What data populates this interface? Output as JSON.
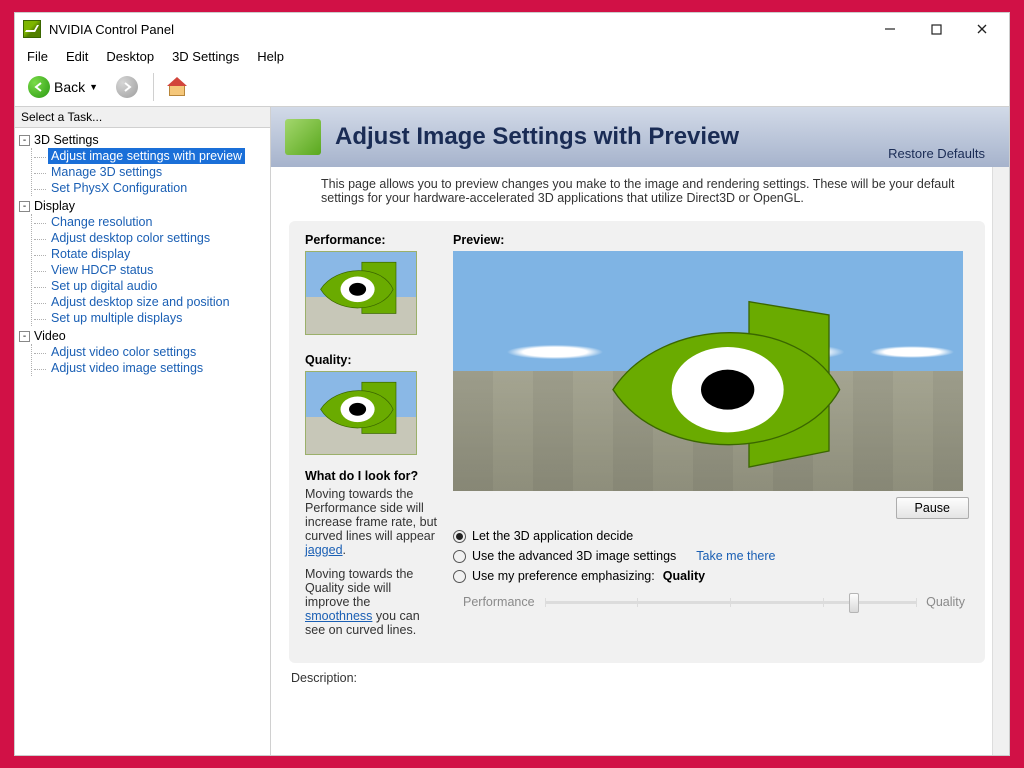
{
  "window": {
    "title": "NVIDIA Control Panel"
  },
  "menu": {
    "file": "File",
    "edit": "Edit",
    "desktop": "Desktop",
    "settings3d": "3D Settings",
    "help": "Help"
  },
  "toolbar": {
    "back": "Back"
  },
  "sidebar": {
    "title": "Select a Task...",
    "categories": [
      {
        "label": "3D Settings",
        "items": [
          "Adjust image settings with preview",
          "Manage 3D settings",
          "Set PhysX Configuration"
        ],
        "selected_index": 0
      },
      {
        "label": "Display",
        "items": [
          "Change resolution",
          "Adjust desktop color settings",
          "Rotate display",
          "View HDCP status",
          "Set up digital audio",
          "Adjust desktop size and position",
          "Set up multiple displays"
        ]
      },
      {
        "label": "Video",
        "items": [
          "Adjust video color settings",
          "Adjust video image settings"
        ]
      }
    ]
  },
  "page": {
    "title": "Adjust Image Settings with Preview",
    "restore": "Restore Defaults",
    "intro": "This page allows you to preview changes you make to the image and rendering settings. These will be your default settings for your hardware-accelerated 3D applications that utilize Direct3D or OpenGL.",
    "labels": {
      "performance": "Performance:",
      "quality": "Quality:",
      "preview": "Preview:"
    },
    "pause": "Pause",
    "options": {
      "o1": "Let the 3D application decide",
      "o2": "Use the advanced 3D image settings",
      "o2_link": "Take me there",
      "o3_prefix": "Use my preference emphasizing:",
      "o3_value": "Quality",
      "selected": 0
    },
    "slider": {
      "left": "Performance",
      "right": "Quality",
      "position": 0.82
    },
    "whatfor": {
      "heading": "What do I look for?",
      "p1a": "Moving towards the Performance side will increase frame rate, but curved lines will appear ",
      "p1_link": "jagged",
      "p1b": ".",
      "p2a": "Moving towards the Quality side will improve the ",
      "p2_link": "smoothness",
      "p2b": " you can see on curved lines."
    },
    "description_label": "Description:"
  }
}
